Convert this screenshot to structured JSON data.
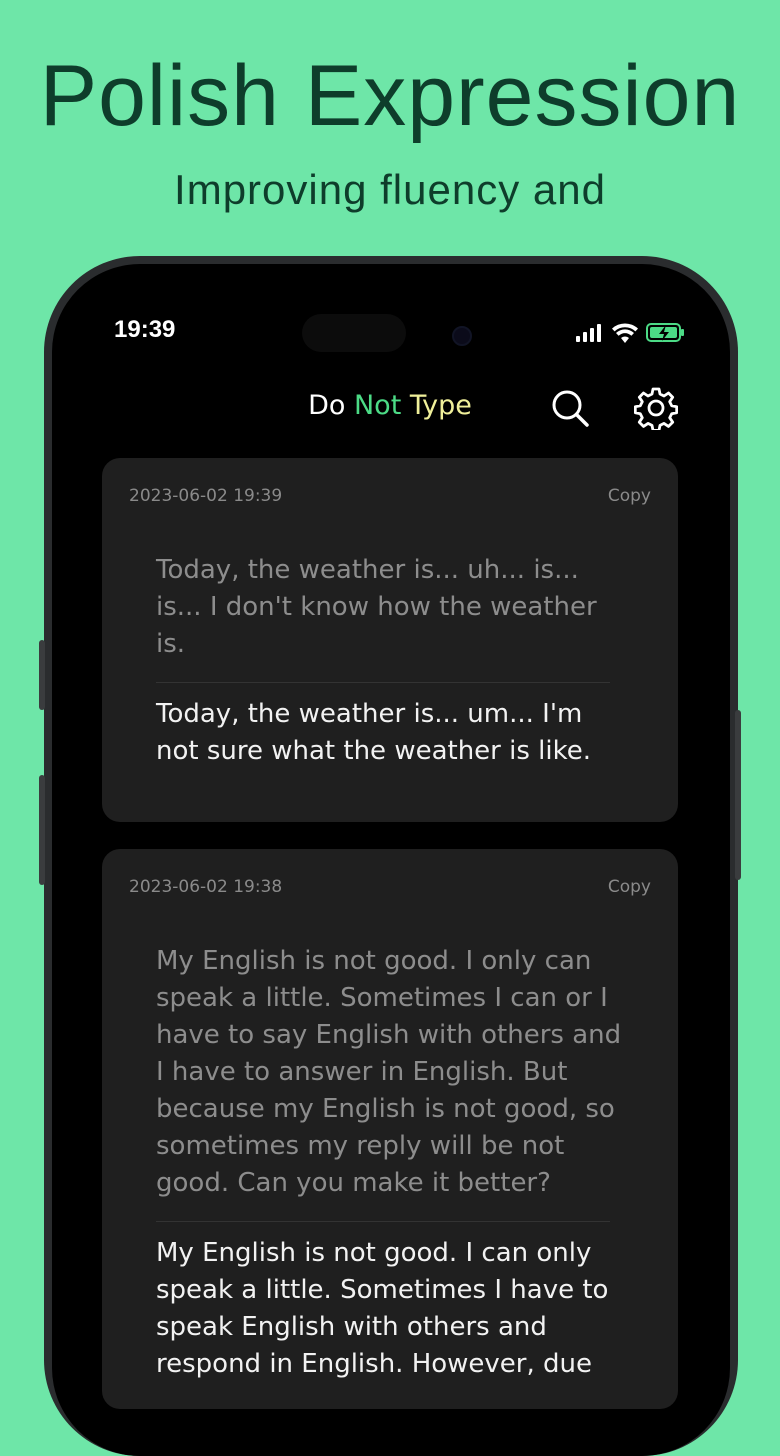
{
  "promo": {
    "headline": "Polish Expression",
    "subline": "Improving fluency and"
  },
  "status_bar": {
    "time": "19:39",
    "icons": [
      "signal-icon",
      "wifi-icon",
      "battery-charging-icon"
    ]
  },
  "app": {
    "title_do": "Do",
    "title_not": "Not",
    "title_type": "Type",
    "colors": {
      "do": "#ffffff",
      "not": "#4cdb86",
      "type": "#f0f09a"
    },
    "icons": [
      "search-icon",
      "gear-icon"
    ]
  },
  "cards": [
    {
      "date": "2023-06-02 19:39",
      "copy": "Copy",
      "original": "Today, the weather is... uh... is... is... I don't know how the weather is.",
      "polished": "Today, the weather is... um... I'm not sure what the weather is like."
    },
    {
      "date": "2023-06-02 19:38",
      "copy": "Copy",
      "original": "My English is not good. I only can speak a little. Sometimes I can or I have to say English with others and I have to answer in English. But because my English is not good, so sometimes my reply will be not good. Can you make it better?",
      "polished": "My English is not good. I can only speak a little. Sometimes I have to speak English with others and respond in English. However, due"
    }
  ]
}
